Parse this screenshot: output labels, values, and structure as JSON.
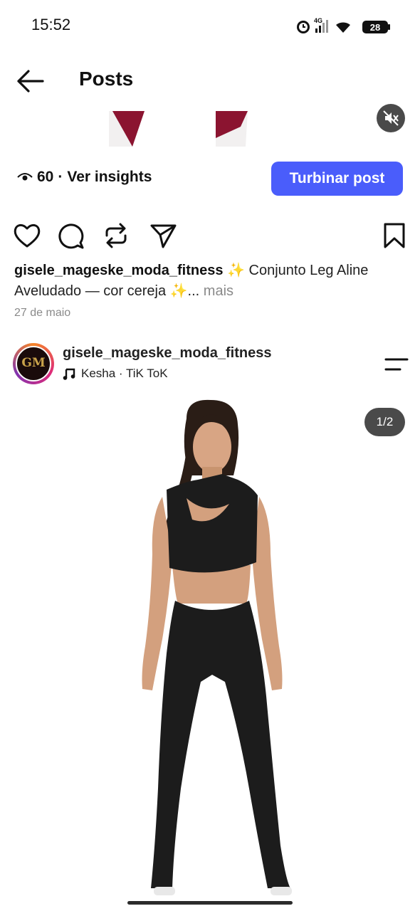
{
  "status_bar": {
    "time": "15:52",
    "network": "4G",
    "battery": "28"
  },
  "header": {
    "title": "Posts"
  },
  "insights": {
    "views": "60",
    "separator": "·",
    "link": "Ver insights",
    "boost_label": "Turbinar post"
  },
  "caption": {
    "username": "gisele_mageske_moda_fitness",
    "text": "✨ Conjunto Leg Aline Aveludado — cor cereja ✨...",
    "more": "mais",
    "date": "27 de maio"
  },
  "next_post": {
    "username": "gisele_mageske_moda_fitness",
    "audio": "Kesha · TiK ToK",
    "counter": "1/2"
  },
  "colors": {
    "accent": "#4a5dfb",
    "pill": "#4a4a4a",
    "muted": "#8a8a8a"
  },
  "icons": [
    "back-arrow-icon",
    "mute-icon",
    "eye-icon",
    "heart-icon",
    "comment-icon",
    "repost-icon",
    "share-icon",
    "bookmark-icon",
    "music-note-icon",
    "menu-icon"
  ]
}
